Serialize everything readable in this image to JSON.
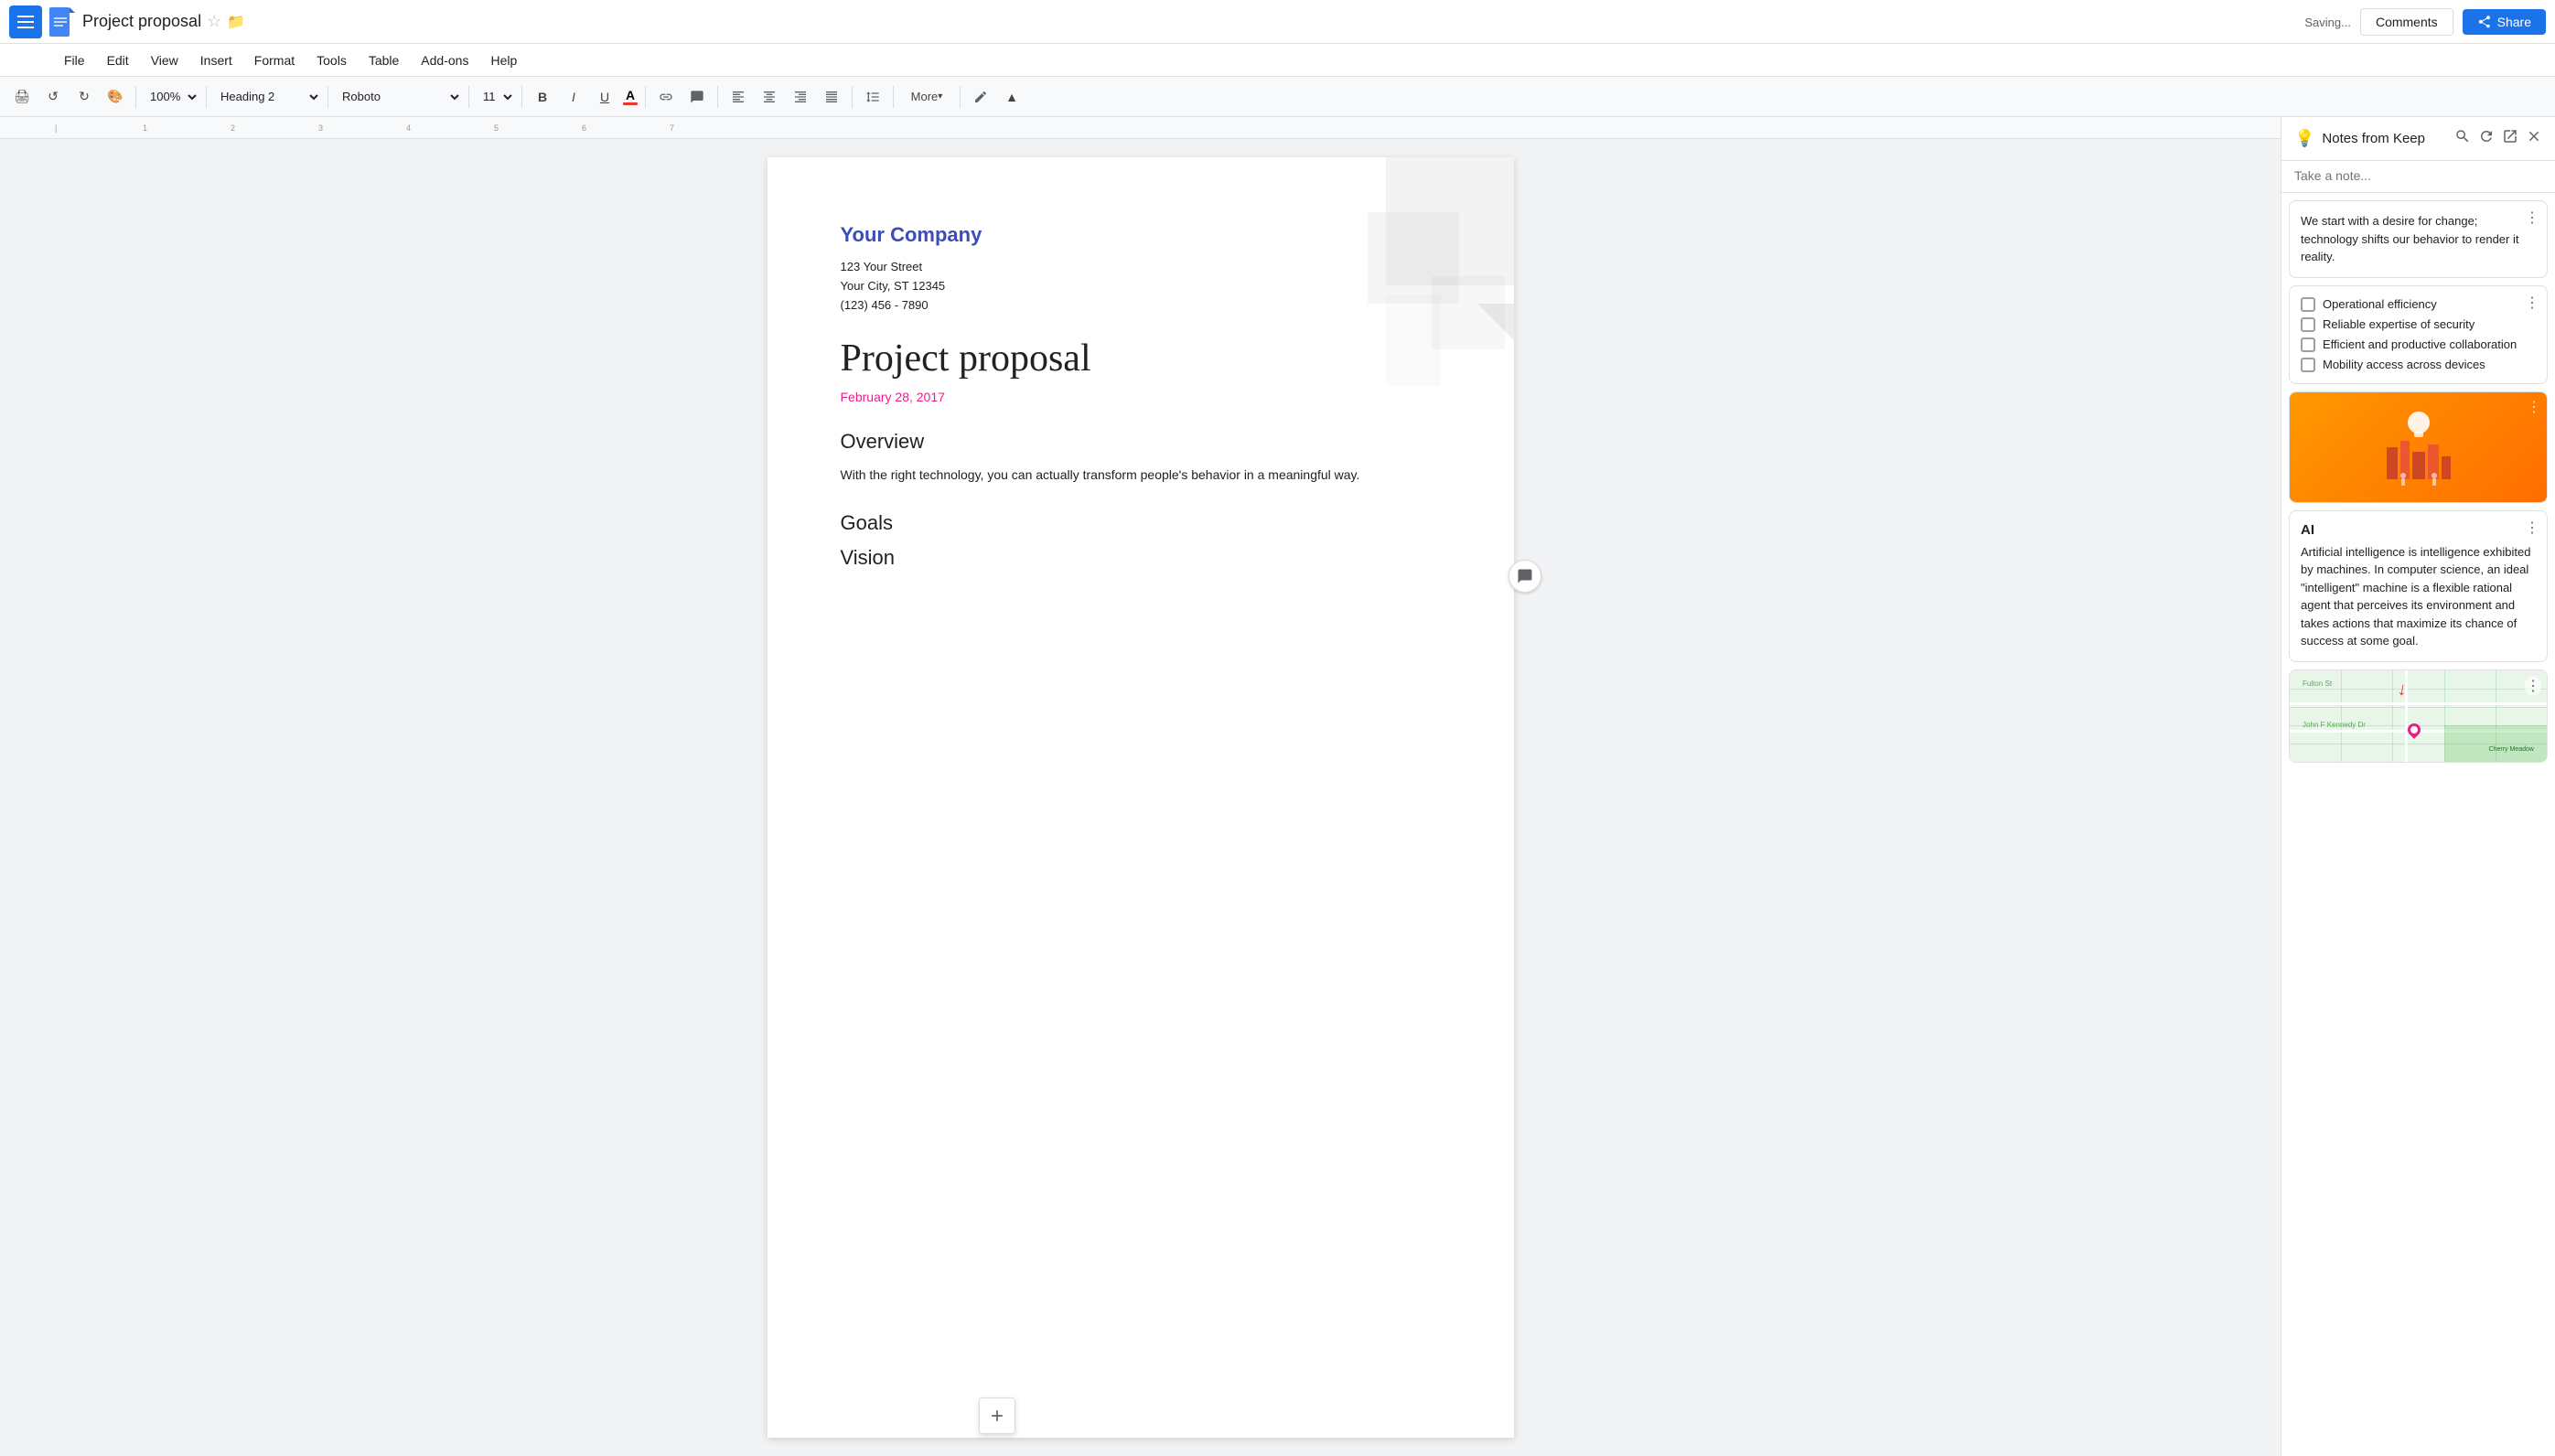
{
  "topBar": {
    "docTitle": "Project proposal",
    "starLabel": "★",
    "folderLabel": "📁",
    "savingStatus": "Saving...",
    "commentsLabel": "Comments",
    "shareLabel": "Share"
  },
  "menuBar": {
    "items": [
      "File",
      "Edit",
      "View",
      "Insert",
      "Format",
      "Tools",
      "Table",
      "Add-ons",
      "Help"
    ]
  },
  "toolbar": {
    "printLabel": "🖨",
    "undoLabel": "↺",
    "redoLabel": "↻",
    "paintLabel": "🎨",
    "zoomLabel": "100%",
    "headingLabel": "Heading 2",
    "fontLabel": "Roboto",
    "sizeLabel": "11",
    "boldLabel": "B",
    "italicLabel": "I",
    "underlineLabel": "U",
    "linkLabel": "🔗",
    "moreLabel": "More"
  },
  "document": {
    "companyName": "Your Company",
    "address1": "123 Your Street",
    "address2": "Your City, ST 12345",
    "address3": "(123) 456 - 7890",
    "title": "Project proposal",
    "date": "February 28, 2017",
    "overviewHeading": "Overview",
    "overviewText": "With the right technology, you can actually transform people's behavior in a meaningful way.",
    "goalsHeading": "Goals",
    "visionHeading": "Vision"
  },
  "keepPanel": {
    "title": "Notes from Keep",
    "searchPlaceholder": "Take a note...",
    "note1": {
      "text": "We start with a desire for change; technology shifts our behavior to render it reality."
    },
    "checklistNote": {
      "items": [
        {
          "label": "Operational efficiency",
          "checked": false
        },
        {
          "label": "Reliable expertise of security",
          "checked": false
        },
        {
          "label": "Efficient and productive collaboration",
          "checked": false
        },
        {
          "label": "Mobility access across devices",
          "checked": false
        }
      ]
    },
    "imageNote": {
      "label": "AI"
    },
    "aiNote": {
      "title": "AI",
      "text": "Artificial intelligence is intelligence exhibited by machines. In computer science, an ideal \"intelligent\" machine is a flexible rational agent that perceives its environment and takes actions that maximize its chance of success at some goal."
    },
    "mapNote": {
      "label": "Map"
    }
  },
  "colors": {
    "accent": "#1a73e8",
    "companyNameColor": "#3c4db5",
    "dateColor": "#e91e8c",
    "keepBulb": "#f9ab00"
  }
}
